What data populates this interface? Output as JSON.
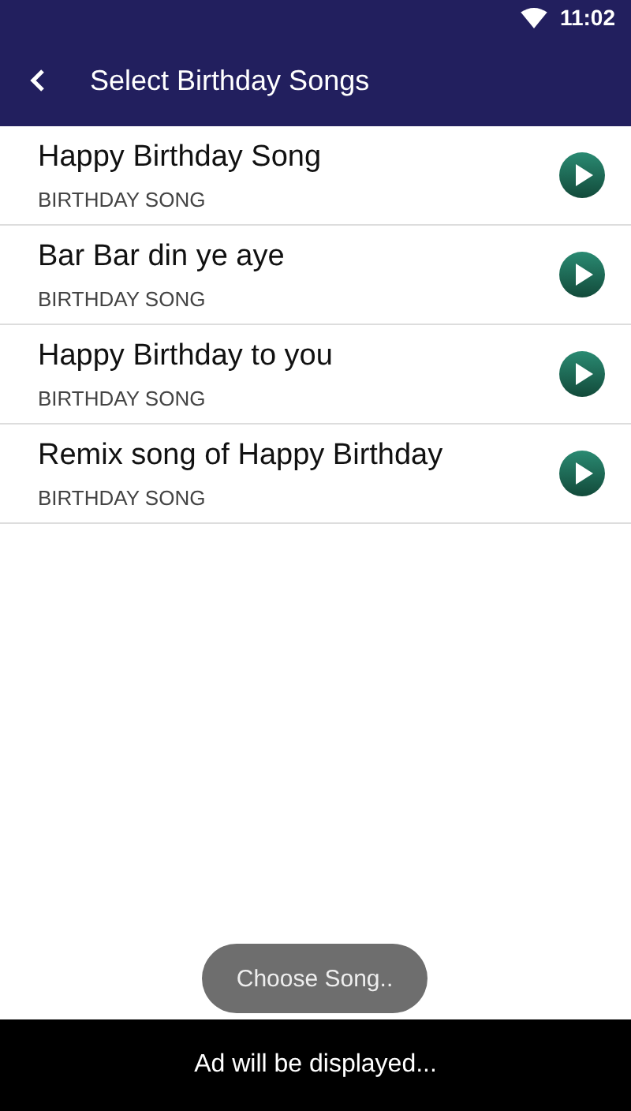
{
  "status_bar": {
    "time": "11:02"
  },
  "app_bar": {
    "title": "Select Birthday Songs"
  },
  "songs": [
    {
      "title": "Happy Birthday Song",
      "subtitle": "BIRTHDAY SONG"
    },
    {
      "title": "Bar Bar din ye aye",
      "subtitle": "BIRTHDAY SONG"
    },
    {
      "title": "Happy Birthday to you",
      "subtitle": "BIRTHDAY SONG"
    },
    {
      "title": "Remix song of Happy Birthday",
      "subtitle": "BIRTHDAY SONG"
    }
  ],
  "toast": "Choose Song..",
  "ad_banner": "Ad will be displayed..."
}
